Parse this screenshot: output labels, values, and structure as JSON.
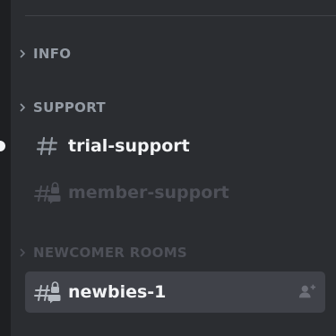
{
  "categories": [
    {
      "label": "INFO"
    },
    {
      "label": "SUPPORT"
    },
    {
      "label": "NEWCOMER ROOMS"
    }
  ],
  "channels": [
    {
      "name": "trial-support",
      "icon": "hashtag-icon",
      "state": "unread"
    },
    {
      "name": "member-support",
      "icon": "locked-hashtag-thread-icon",
      "state": "muted"
    },
    {
      "name": "newbies-1",
      "icon": "locked-hashtag-thread-icon",
      "state": "selected"
    }
  ],
  "colors": {
    "background": "#2b2d31",
    "selected": "#404249",
    "category_text": "#949ba4",
    "unread_text": "#f2f3f5",
    "muted_text": "#4e5058"
  }
}
